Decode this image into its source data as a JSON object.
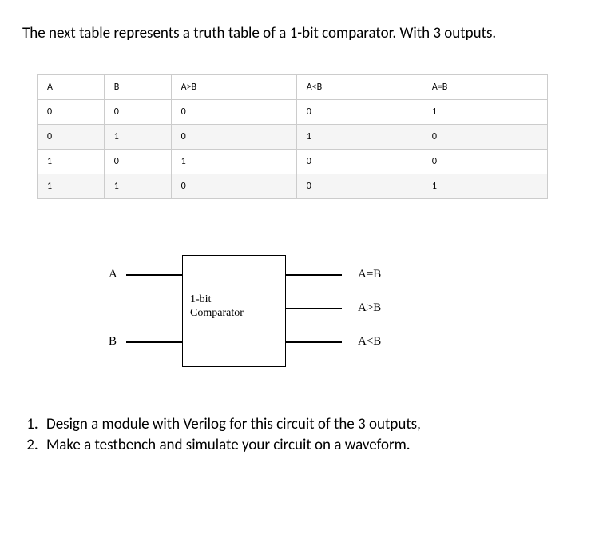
{
  "intro": "The next table represents a truth table of a 1-bit comparator. With 3 outputs.",
  "table": {
    "headers": [
      "A",
      "B",
      "A>B",
      "A<B",
      "A=B"
    ],
    "rows": [
      [
        "0",
        "0",
        "0",
        "0",
        "1"
      ],
      [
        "0",
        "1",
        "0",
        "1",
        "0"
      ],
      [
        "1",
        "0",
        "1",
        "0",
        "0"
      ],
      [
        "1",
        "1",
        "0",
        "0",
        "1"
      ]
    ]
  },
  "diagram": {
    "inputA": "A",
    "inputB": "B",
    "boxLine1": "1-bit",
    "boxLine2": "Comparator",
    "out1": "A=B",
    "out2": "A>B",
    "out3": "A<B"
  },
  "questions": {
    "q1": "Design a module with Verilog for this circuit of the 3 outputs,",
    "q2": "Make a testbench and simulate your circuit on a waveform."
  }
}
